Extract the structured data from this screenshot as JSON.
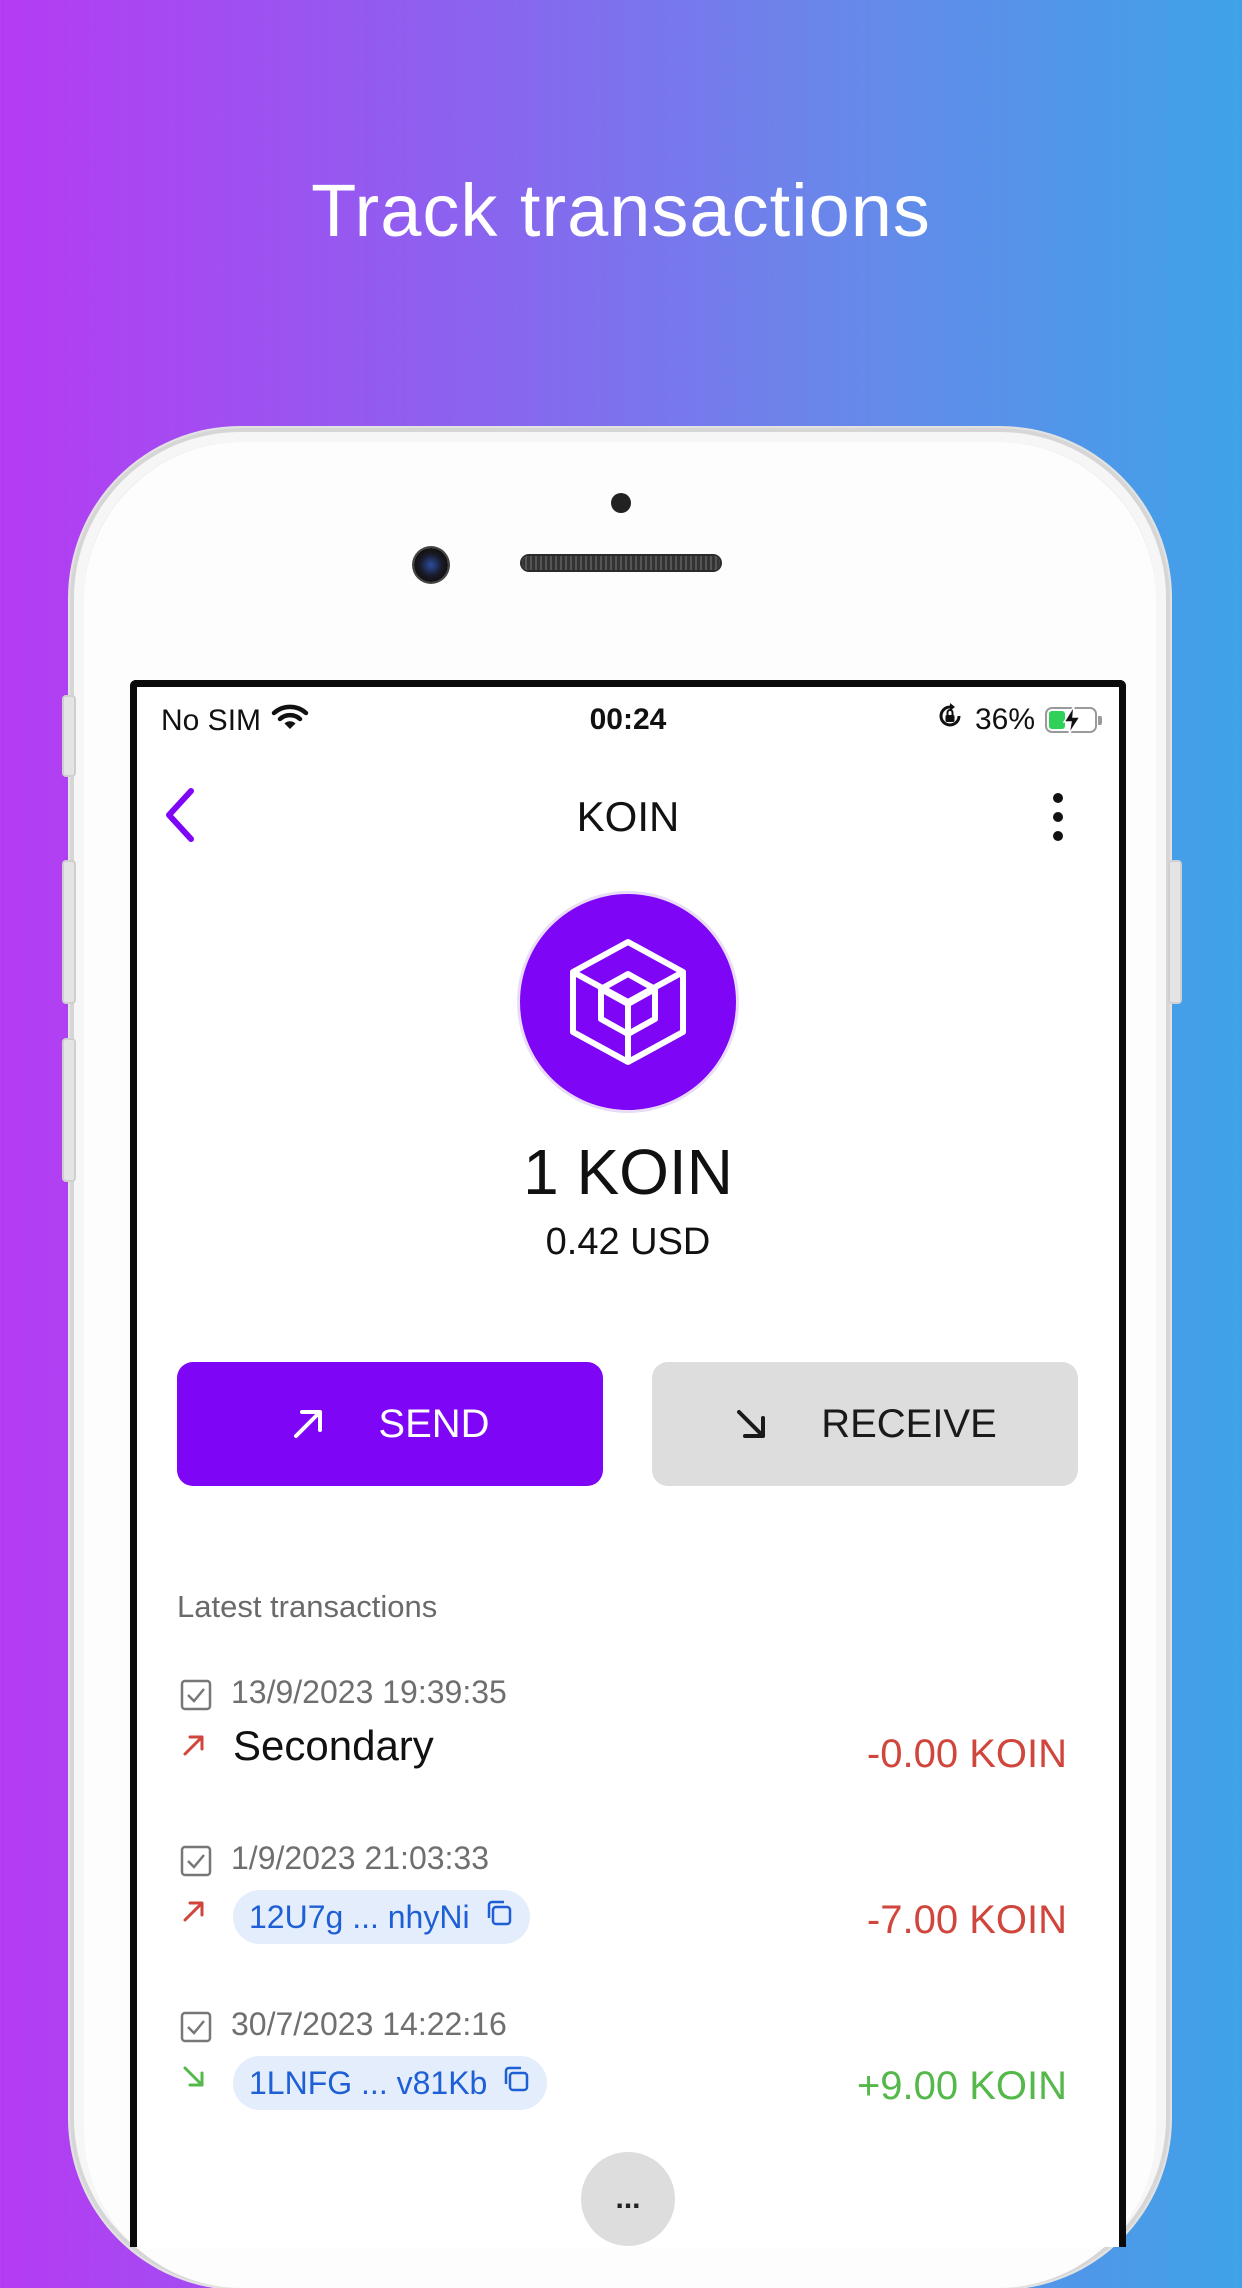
{
  "headline": "Track transactions",
  "status_bar": {
    "carrier": "No SIM",
    "time": "00:24",
    "battery_percent": "36%",
    "battery_level": 0.36,
    "icons": [
      "wifi-icon",
      "orientation-lock-icon",
      "battery-charging-icon"
    ]
  },
  "header": {
    "title": "KOIN",
    "back_icon": "chevron-left-icon",
    "menu_icon": "more-vertical-icon"
  },
  "asset": {
    "logo_icon": "cube-icon",
    "balance": "1 KOIN",
    "fiat_value": "0.42 USD"
  },
  "actions": {
    "send_label": "SEND",
    "receive_label": "RECEIVE"
  },
  "transactions": {
    "section_title": "Latest transactions",
    "items": [
      {
        "date": "13/9/2023 19:39:35",
        "name": "Secondary",
        "direction": "outgoing",
        "amount": "-0.00 KOIN"
      },
      {
        "date": "1/9/2023 21:03:33",
        "address": "12U7g ... nhyNi",
        "direction": "outgoing",
        "amount": "-7.00 KOIN"
      },
      {
        "date": "30/7/2023 14:22:16",
        "address": "1LNFG ... v81Kb",
        "direction": "incoming",
        "amount": "+9.00 KOIN"
      }
    ],
    "load_more_label": "..."
  },
  "colors": {
    "accent": "#7e05f5",
    "negative": "#d0463c",
    "positive": "#55b84a",
    "address_chip": "#e3edfb",
    "address_text": "#1e5fd6"
  }
}
